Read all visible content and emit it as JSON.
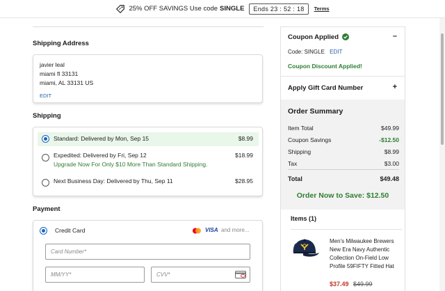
{
  "promo": {
    "text": "25% OFF SAVINGS Use code",
    "code": "SINGLE",
    "timer": "Ends 23 : 52 : 18",
    "terms": "Terms"
  },
  "shipping_address": {
    "heading": "Shipping Address",
    "lines": [
      "javier leal",
      "miami fl 33131",
      "miami, AL 33131 US"
    ],
    "edit_label": "EDIT"
  },
  "shipping": {
    "heading": "Shipping",
    "options": [
      {
        "label": "Standard: Delivered by Mon, Sep 15",
        "price": "$8.99",
        "selected": true
      },
      {
        "label": "Expedited: Delivered by Fri, Sep 12",
        "price": "$18.99",
        "selected": false,
        "note": "Upgrade Now For Only $10 More Than Standard Shipping."
      },
      {
        "label": "Next Business Day: Delivered by Thu, Sep 11",
        "price": "$28.95",
        "selected": false
      }
    ]
  },
  "payment": {
    "heading": "Payment",
    "method_label": "Credit Card",
    "brand_visa": "VISA",
    "more_label": "and more...",
    "card_number_placeholder": "Card Number*",
    "expiry_placeholder": "MM/YY*",
    "cvv_placeholder": "CVV*"
  },
  "coupon": {
    "heading": "Coupon Applied",
    "code_label": "Code: SINGLE",
    "edit_label": "EDIT",
    "applied_message": "Coupon Discount Applied!",
    "collapse_symbol": "–"
  },
  "gift_card": {
    "heading": "Apply Gift Card Number",
    "expand_symbol": "+"
  },
  "order_summary": {
    "heading": "Order Summary",
    "rows": [
      {
        "label": "Item Total",
        "value": "$49.99"
      },
      {
        "label": "Coupon Savings",
        "value": "-$12.50"
      },
      {
        "label": "Shipping",
        "value": "$8.99"
      },
      {
        "label": "Tax",
        "value": "$3.00"
      }
    ],
    "total_label": "Total",
    "total_value": "$49.48",
    "cta": "Order Now to Save: $12.50"
  },
  "items": {
    "heading": "Items (1)",
    "product": {
      "name": "Men's Milwaukee Brewers New Era Navy Authentic Collection On-Field Low Profile 59FIFTY Fitted Hat",
      "sale_price": "$37.49",
      "original_price": "$49.99"
    }
  },
  "colors": {
    "accent_blue": "#1565c0",
    "success_green": "#2e7d32",
    "sale_red": "#c0392b",
    "link_blue": "#1f5fa8"
  },
  "icons": [
    "tag-icon",
    "check-circle-icon",
    "mastercard-icon",
    "cvv-card-icon",
    "hat-image"
  ]
}
